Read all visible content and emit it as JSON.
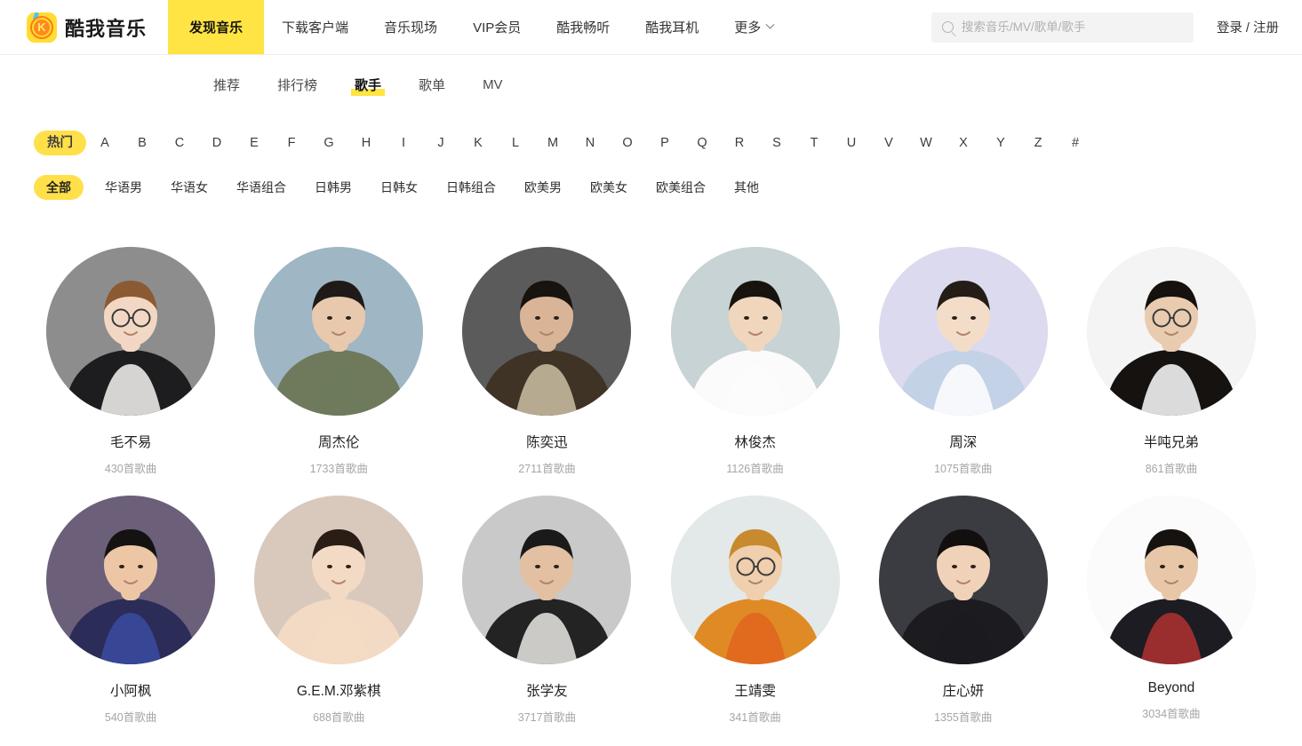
{
  "header": {
    "brand_name": "酷我音乐",
    "brand_logo_letter": "K",
    "nav_items": [
      {
        "label": "发现音乐",
        "active": true
      },
      {
        "label": "下载客户端",
        "active": false
      },
      {
        "label": "音乐现场",
        "active": false
      },
      {
        "label": "VIP会员",
        "active": false
      },
      {
        "label": "酷我畅听",
        "active": false
      },
      {
        "label": "酷我耳机",
        "active": false
      },
      {
        "label": "更多",
        "active": false,
        "has_caret": true
      }
    ],
    "search": {
      "placeholder": "搜索音乐/MV/歌单/歌手",
      "value": "",
      "icon": "search-icon"
    },
    "login_label": "登录 / 注册"
  },
  "subtabs": [
    {
      "label": "推荐",
      "active": false
    },
    {
      "label": "排行榜",
      "active": false
    },
    {
      "label": "歌手",
      "active": true
    },
    {
      "label": "歌单",
      "active": false
    },
    {
      "label": "MV",
      "active": false
    }
  ],
  "filters": {
    "letters": [
      {
        "label": "热门",
        "active": true
      },
      {
        "label": "A",
        "active": false
      },
      {
        "label": "B",
        "active": false
      },
      {
        "label": "C",
        "active": false
      },
      {
        "label": "D",
        "active": false
      },
      {
        "label": "E",
        "active": false
      },
      {
        "label": "F",
        "active": false
      },
      {
        "label": "G",
        "active": false
      },
      {
        "label": "H",
        "active": false
      },
      {
        "label": "I",
        "active": false
      },
      {
        "label": "J",
        "active": false
      },
      {
        "label": "K",
        "active": false
      },
      {
        "label": "L",
        "active": false
      },
      {
        "label": "M",
        "active": false
      },
      {
        "label": "N",
        "active": false
      },
      {
        "label": "O",
        "active": false
      },
      {
        "label": "P",
        "active": false
      },
      {
        "label": "Q",
        "active": false
      },
      {
        "label": "R",
        "active": false
      },
      {
        "label": "S",
        "active": false
      },
      {
        "label": "T",
        "active": false
      },
      {
        "label": "U",
        "active": false
      },
      {
        "label": "V",
        "active": false
      },
      {
        "label": "W",
        "active": false
      },
      {
        "label": "X",
        "active": false
      },
      {
        "label": "Y",
        "active": false
      },
      {
        "label": "Z",
        "active": false
      },
      {
        "label": "#",
        "active": false
      }
    ],
    "categories": [
      {
        "label": "全部",
        "active": true
      },
      {
        "label": "华语男",
        "active": false
      },
      {
        "label": "华语女",
        "active": false
      },
      {
        "label": "华语组合",
        "active": false
      },
      {
        "label": "日韩男",
        "active": false
      },
      {
        "label": "日韩女",
        "active": false
      },
      {
        "label": "日韩组合",
        "active": false
      },
      {
        "label": "欧美男",
        "active": false
      },
      {
        "label": "欧美女",
        "active": false
      },
      {
        "label": "欧美组合",
        "active": false
      },
      {
        "label": "其他",
        "active": false
      }
    ]
  },
  "artists": [
    {
      "name": "毛不易",
      "count": "430首歌曲",
      "bg": "#8d8d8d",
      "skin": "#f2d8c4",
      "hair": "#8b5a33",
      "cloth": "#1d1d1f",
      "shirt": "#f7f5f2",
      "glasses": true
    },
    {
      "name": "周杰伦",
      "count": "1733首歌曲",
      "bg": "#9fb6c4",
      "skin": "#e8c9ae",
      "hair": "#1f1a17",
      "cloth": "#6f7a5c",
      "shirt": "#6f7a5c",
      "glasses": false
    },
    {
      "name": "陈奕迅",
      "count": "2711首歌曲",
      "bg": "#5b5b5b",
      "skin": "#d9b496",
      "hair": "#17130f",
      "cloth": "#3f3326",
      "shirt": "#cbbfa4",
      "glasses": false
    },
    {
      "name": "林俊杰",
      "count": "1126首歌曲",
      "bg": "#c7d3d4",
      "skin": "#f0d6bd",
      "hair": "#17130f",
      "cloth": "#fbfbfb",
      "shirt": "#fbfbfb",
      "glasses": false
    },
    {
      "name": "周深",
      "count": "1075首歌曲",
      "bg": "#dcdaee",
      "skin": "#f3ddc8",
      "hair": "#241c16",
      "cloth": "#c3d2e6",
      "shirt": "#ffffff",
      "glasses": false
    },
    {
      "name": "半吨兄弟",
      "count": "861首歌曲",
      "bg": "#f4f4f4",
      "skin": "#e9cbb0",
      "hair": "#14110e",
      "cloth": "#15120f",
      "shirt": "#ffffff",
      "glasses": true
    },
    {
      "name": "小阿枫",
      "count": "540首歌曲",
      "bg": "#6b5f7a",
      "skin": "#edc7a5",
      "hair": "#151312",
      "cloth": "#2b2d58",
      "shirt": "#3a4ba0",
      "glasses": false
    },
    {
      "name": "G.E.M.邓紫棋",
      "count": "688首歌曲",
      "bg": "#d9c9bd",
      "skin": "#f3dac4",
      "hair": "#2a1d16",
      "cloth": "#f3dac4",
      "shirt": "#f3dac4",
      "glasses": false
    },
    {
      "name": "张学友",
      "count": "3717首歌曲",
      "bg": "#c9c9c9",
      "skin": "#e3c0a2",
      "hair": "#1a1a1a",
      "cloth": "#232323",
      "shirt": "#e9e7e4",
      "glasses": false
    },
    {
      "name": "王靖雯",
      "count": "341首歌曲",
      "bg": "#e2e9e8",
      "skin": "#f0cfae",
      "hair": "#c78a2e",
      "cloth": "#e08a26",
      "shirt": "#e0641f",
      "glasses": true
    },
    {
      "name": "庄心妍",
      "count": "1355首歌曲",
      "bg": "#3b3b42",
      "skin": "#f0d2b8",
      "hair": "#120f0e",
      "cloth": "#1b1b20",
      "shirt": "#1b1b20",
      "glasses": false
    },
    {
      "name": "Beyond",
      "count": "3034首歌曲",
      "bg": "#fbfbfb",
      "skin": "#e8c7a8",
      "hair": "#16120f",
      "cloth": "#1c1c22",
      "shirt": "#b03030",
      "glasses": false
    }
  ],
  "colors": {
    "accent_yellow": "#ffe443",
    "pill_yellow": "#ffe04a",
    "text_primary": "#1f1f1f",
    "text_muted": "#a6a6a6"
  }
}
